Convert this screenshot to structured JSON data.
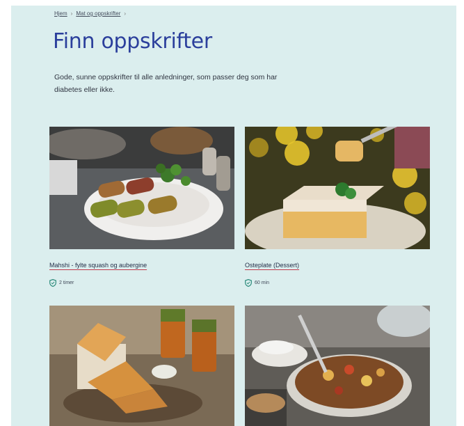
{
  "breadcrumb": {
    "home": "Hjem",
    "section": "Mat og oppskrifter"
  },
  "page": {
    "title": "Finn oppskrifter",
    "intro": "Gode, sunne oppskrifter til alle anledninger, som passer deg som har diabetes eller ikke."
  },
  "recipes": [
    {
      "title": "Mahshi - fylte squash og aubergine",
      "time": "2 timer",
      "icon": "shield-icon"
    },
    {
      "title": "Osteplate (Dessert)",
      "time": "60 min",
      "icon": "shield-icon"
    },
    {
      "title": "",
      "time": ""
    },
    {
      "title": "",
      "time": ""
    }
  ],
  "colors": {
    "background": "#dbeeee",
    "heading": "#2b3f9c",
    "link_underline": "#c0394b"
  }
}
